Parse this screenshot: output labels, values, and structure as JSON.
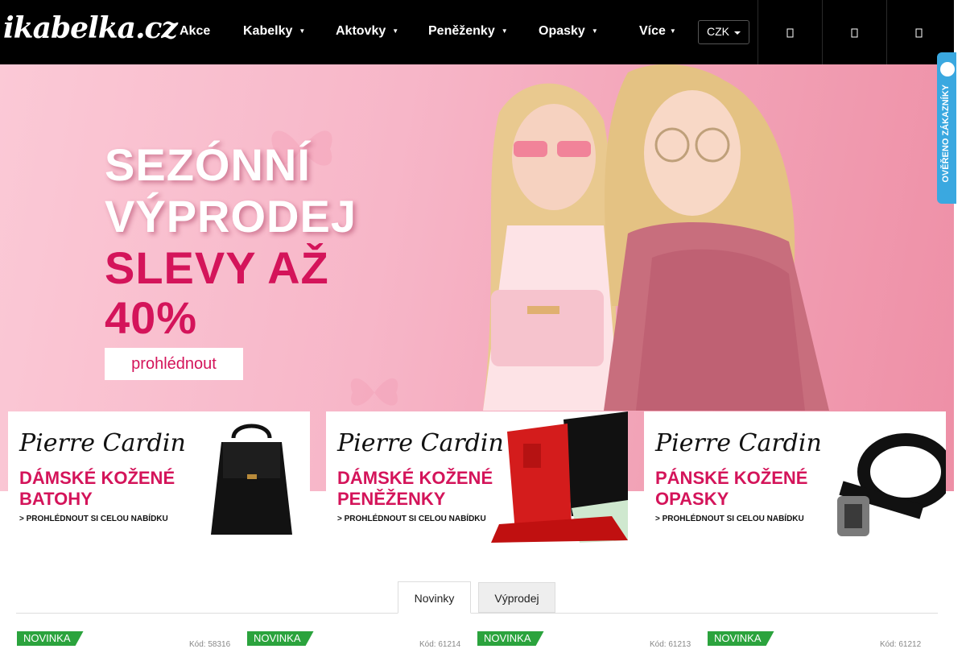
{
  "header": {
    "logo": "ikabelka.cz",
    "nav": [
      {
        "label": "Akce",
        "dropdown": false
      },
      {
        "label": "Kabelky",
        "dropdown": true
      },
      {
        "label": "Aktovky",
        "dropdown": true
      },
      {
        "label": "Peněženky",
        "dropdown": true
      },
      {
        "label": "Opasky",
        "dropdown": true
      },
      {
        "label": "Více",
        "dropdown": true
      }
    ],
    "currency": "CZK",
    "icons": [
      "search-icon",
      "user-icon",
      "cart-icon"
    ]
  },
  "hero": {
    "line1": "SEZÓNNÍ",
    "line2": "VÝPRODEJ",
    "line3": "SLEVY AŽ",
    "line4": "40%",
    "button": "prohlédnout",
    "accent_color": "#d4145a"
  },
  "promos": [
    {
      "brand": "Pierre Cardin",
      "title1": "DÁMSKÉ KOŽENÉ",
      "title2": "BATOHY",
      "more": "> PROHLÉDNOUT SI CELOU NABÍDKU"
    },
    {
      "brand": "Pierre Cardin",
      "title1": "DÁMSKÉ KOŽENÉ",
      "title2": "PENĚŽENKY",
      "more": "> PROHLÉDNOUT SI CELOU NABÍDKU"
    },
    {
      "brand": "Pierre Cardin",
      "title1": "PÁNSKÉ KOŽENÉ",
      "title2": "OPASKY",
      "more": "> PROHLÉDNOUT SI CELOU NABÍDKU"
    }
  ],
  "tabs": {
    "new": "Novinky",
    "sale": "Výprodej"
  },
  "products": [
    {
      "badge": "NOVINKA",
      "code": "Kód: 58316"
    },
    {
      "badge": "NOVINKA",
      "code": "Kód: 61214"
    },
    {
      "badge": "NOVINKA",
      "code": "Kód: 61213"
    },
    {
      "badge": "NOVINKA",
      "code": "Kód: 61212"
    }
  ],
  "side_widget": {
    "label": "OVĚŘENO ZÁKAZNÍKY"
  }
}
